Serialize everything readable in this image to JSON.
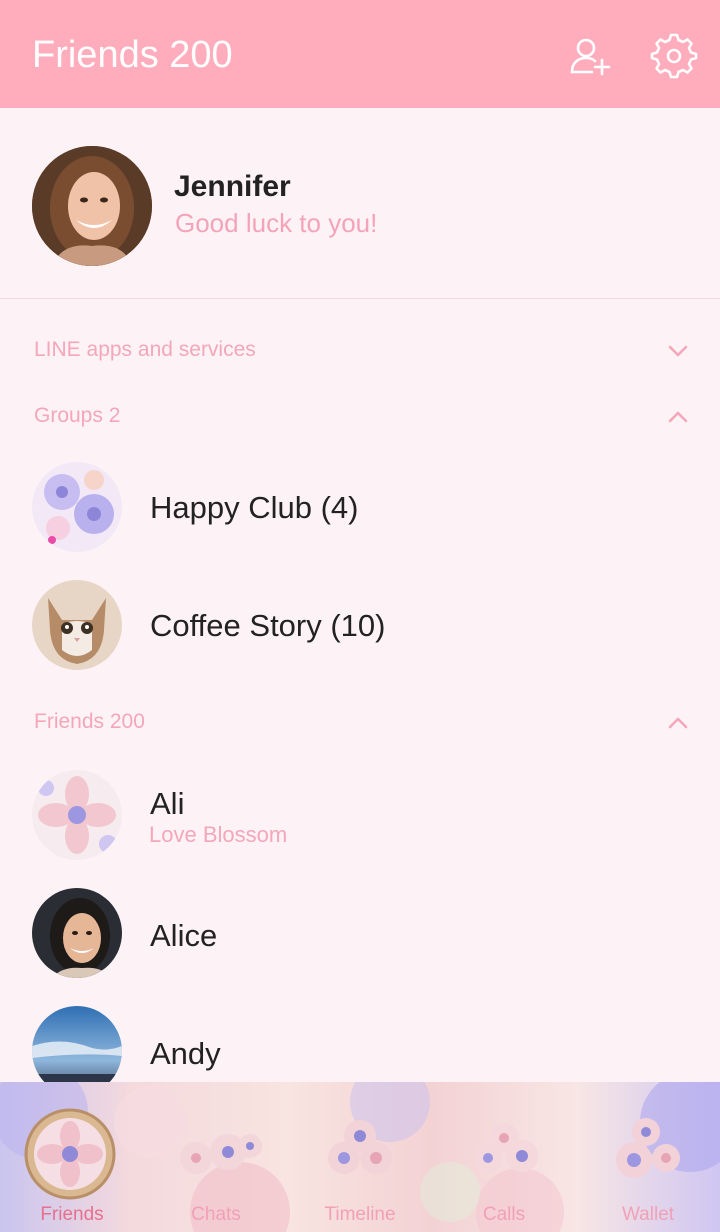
{
  "header": {
    "title": "Friends 200"
  },
  "profile": {
    "name": "Jennifer",
    "status": "Good luck to you!"
  },
  "sections": {
    "services": "LINE apps and services",
    "groups": "Groups 2",
    "friends": "Friends 200"
  },
  "groups": [
    {
      "name": "Happy Club (4)"
    },
    {
      "name": "Coffee Story (10)"
    }
  ],
  "friends": [
    {
      "name": "Ali",
      "status": "Love Blossom"
    },
    {
      "name": "Alice"
    },
    {
      "name": "Andy"
    }
  ],
  "tabs": [
    {
      "label": "Friends"
    },
    {
      "label": "Chats"
    },
    {
      "label": "Timeline"
    },
    {
      "label": "Calls"
    },
    {
      "label": "Wallet"
    }
  ],
  "colors": {
    "header": "#ffadbd",
    "accent": "#f4a6ba",
    "background": "#fdf3f6"
  },
  "icons": {
    "add_friend": "add-friend-icon",
    "settings": "gear-icon",
    "expand": "chevron-down-icon",
    "collapse": "chevron-up-icon"
  }
}
